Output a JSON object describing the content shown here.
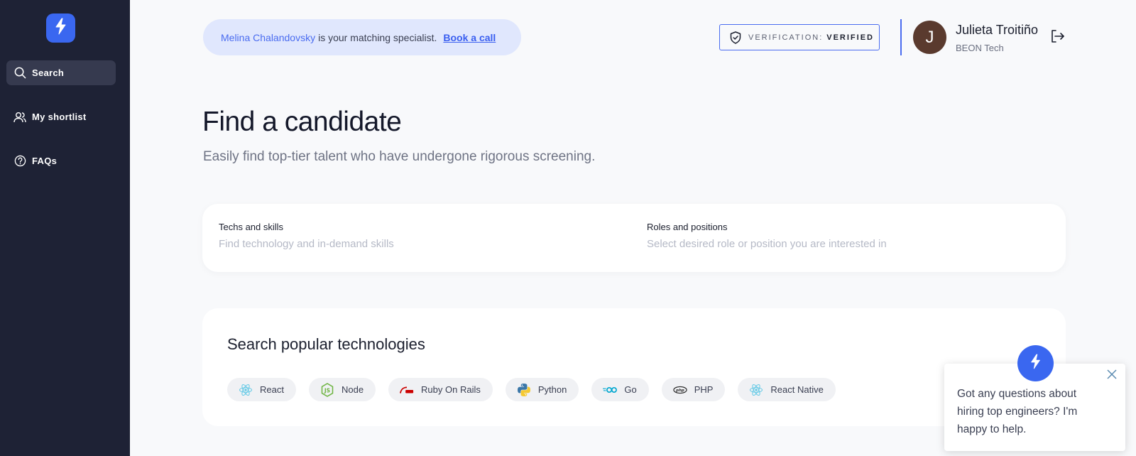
{
  "brand": {
    "logo_icon": "lightning-bolt-icon",
    "accent": "#3a67f0"
  },
  "sidebar": {
    "background": "#1e2235",
    "items": [
      {
        "label": "Search",
        "icon": "search-icon",
        "active": true
      },
      {
        "label": "My shortlist",
        "icon": "users-icon",
        "active": false
      },
      {
        "label": "FAQs",
        "icon": "question-circle-icon",
        "active": false
      }
    ]
  },
  "header": {
    "specialist": {
      "name": "Melina Chalandovsky",
      "text": "is your matching specialist.",
      "link": "Book a call"
    },
    "verification": {
      "label": "VERIFICATION:",
      "value": "VERIFIED"
    },
    "user": {
      "initial": "J",
      "name": "Julieta Troitiño",
      "company": "BEON Tech"
    }
  },
  "main": {
    "title": "Find a candidate",
    "subtitle": "Easily find top-tier talent who have undergone rigorous screening.",
    "search": {
      "techs": {
        "label": "Techs and skills",
        "placeholder": "Find technology and in-demand skills"
      },
      "roles": {
        "label": "Roles and positions",
        "placeholder": "Select desired role or position you are interested in"
      }
    },
    "popular": {
      "title": "Search popular technologies",
      "chips": [
        {
          "label": "React",
          "icon": "react-icon"
        },
        {
          "label": "Node",
          "icon": "nodejs-icon"
        },
        {
          "label": "Ruby On Rails",
          "icon": "rails-icon"
        },
        {
          "label": "Python",
          "icon": "python-icon"
        },
        {
          "label": "Go",
          "icon": "go-icon"
        },
        {
          "label": "PHP",
          "icon": "php-icon"
        },
        {
          "label": "React Native",
          "icon": "react-icon"
        }
      ]
    }
  },
  "chat": {
    "message": "Got any questions about hiring top engineers? I'm happy to help."
  }
}
